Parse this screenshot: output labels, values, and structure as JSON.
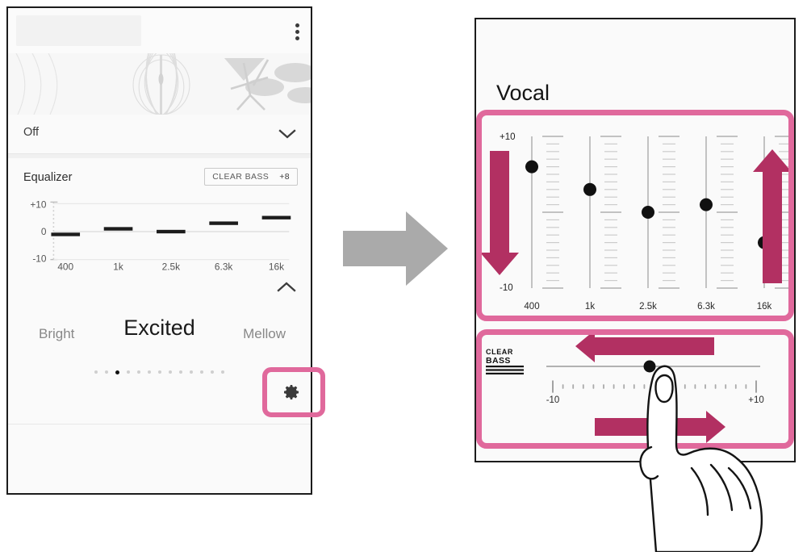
{
  "colors": {
    "accent_dark": "#b23062",
    "accent_light": "#e0699c",
    "panel_bg": "#fafafa",
    "frame": "#1c1c1c",
    "gray_arrow": "#aaaaaa",
    "text_dark": "#1a1a1a",
    "text_muted": "#888888"
  },
  "left_panel": {
    "menu_icon": "kebab-menu-icon",
    "sound_effect_value": "Off",
    "collapse_icon": "chevron-down-icon",
    "equalizer": {
      "title": "Equalizer",
      "clear_bass_label": "CLEAR BASS",
      "clear_bass_value": "+8",
      "expand_icon": "chevron-up-icon"
    },
    "mood": {
      "left": "Bright",
      "center": "Excited",
      "right": "Mellow",
      "dot_count": 13,
      "active_dot_index": 2
    },
    "settings_icon": "gear-icon"
  },
  "middle": {
    "flow_icon": "arrow-right-icon"
  },
  "right_panel": {
    "preset_title": "Vocal",
    "slider_panel": {
      "max_label": "+10",
      "min_label": "-10",
      "down_arrow_icon": "arrow-down-icon",
      "up_arrow_icon": "arrow-up-icon"
    },
    "clear_bass_panel": {
      "logo_top": "CLEAR",
      "logo_bottom": "BASS",
      "min_label": "-10",
      "max_label": "+10",
      "left_arrow_icon": "arrow-left-icon",
      "right_arrow_icon": "arrow-right-icon",
      "hand_icon": "hand-drag-icon"
    }
  },
  "chart_data": [
    {
      "type": "bar",
      "name": "equalizer-preview",
      "title": "Equalizer",
      "categories": [
        "400",
        "1k",
        "2.5k",
        "6.3k",
        "16k"
      ],
      "values": [
        -1,
        1,
        0,
        3,
        5
      ],
      "ylim": [
        -10,
        10
      ],
      "ytick_labels": [
        "+10",
        "0",
        "-10"
      ],
      "xlabel": "",
      "ylabel": "",
      "grid": false,
      "legend": "none"
    },
    {
      "type": "bar",
      "name": "vocal-equalizer-sliders",
      "title": "Vocal",
      "categories": [
        "400",
        "1k",
        "2.5k",
        "6.3k",
        "16k"
      ],
      "values": [
        6,
        3,
        0,
        1,
        -4
      ],
      "ylim": [
        -10,
        10
      ],
      "ytick_labels": [
        "+10",
        "-10"
      ],
      "xlabel": "",
      "ylabel": "",
      "grid": false,
      "legend": "none"
    },
    {
      "type": "bar",
      "name": "clear-bass-slider",
      "title": "CLEAR BASS",
      "categories": [
        "CLEAR BASS"
      ],
      "values": [
        2
      ],
      "ylim": [
        -10,
        10
      ],
      "ytick_labels": [
        "-10",
        "+10"
      ],
      "xlabel": "",
      "ylabel": "",
      "grid": false,
      "legend": "none"
    }
  ]
}
